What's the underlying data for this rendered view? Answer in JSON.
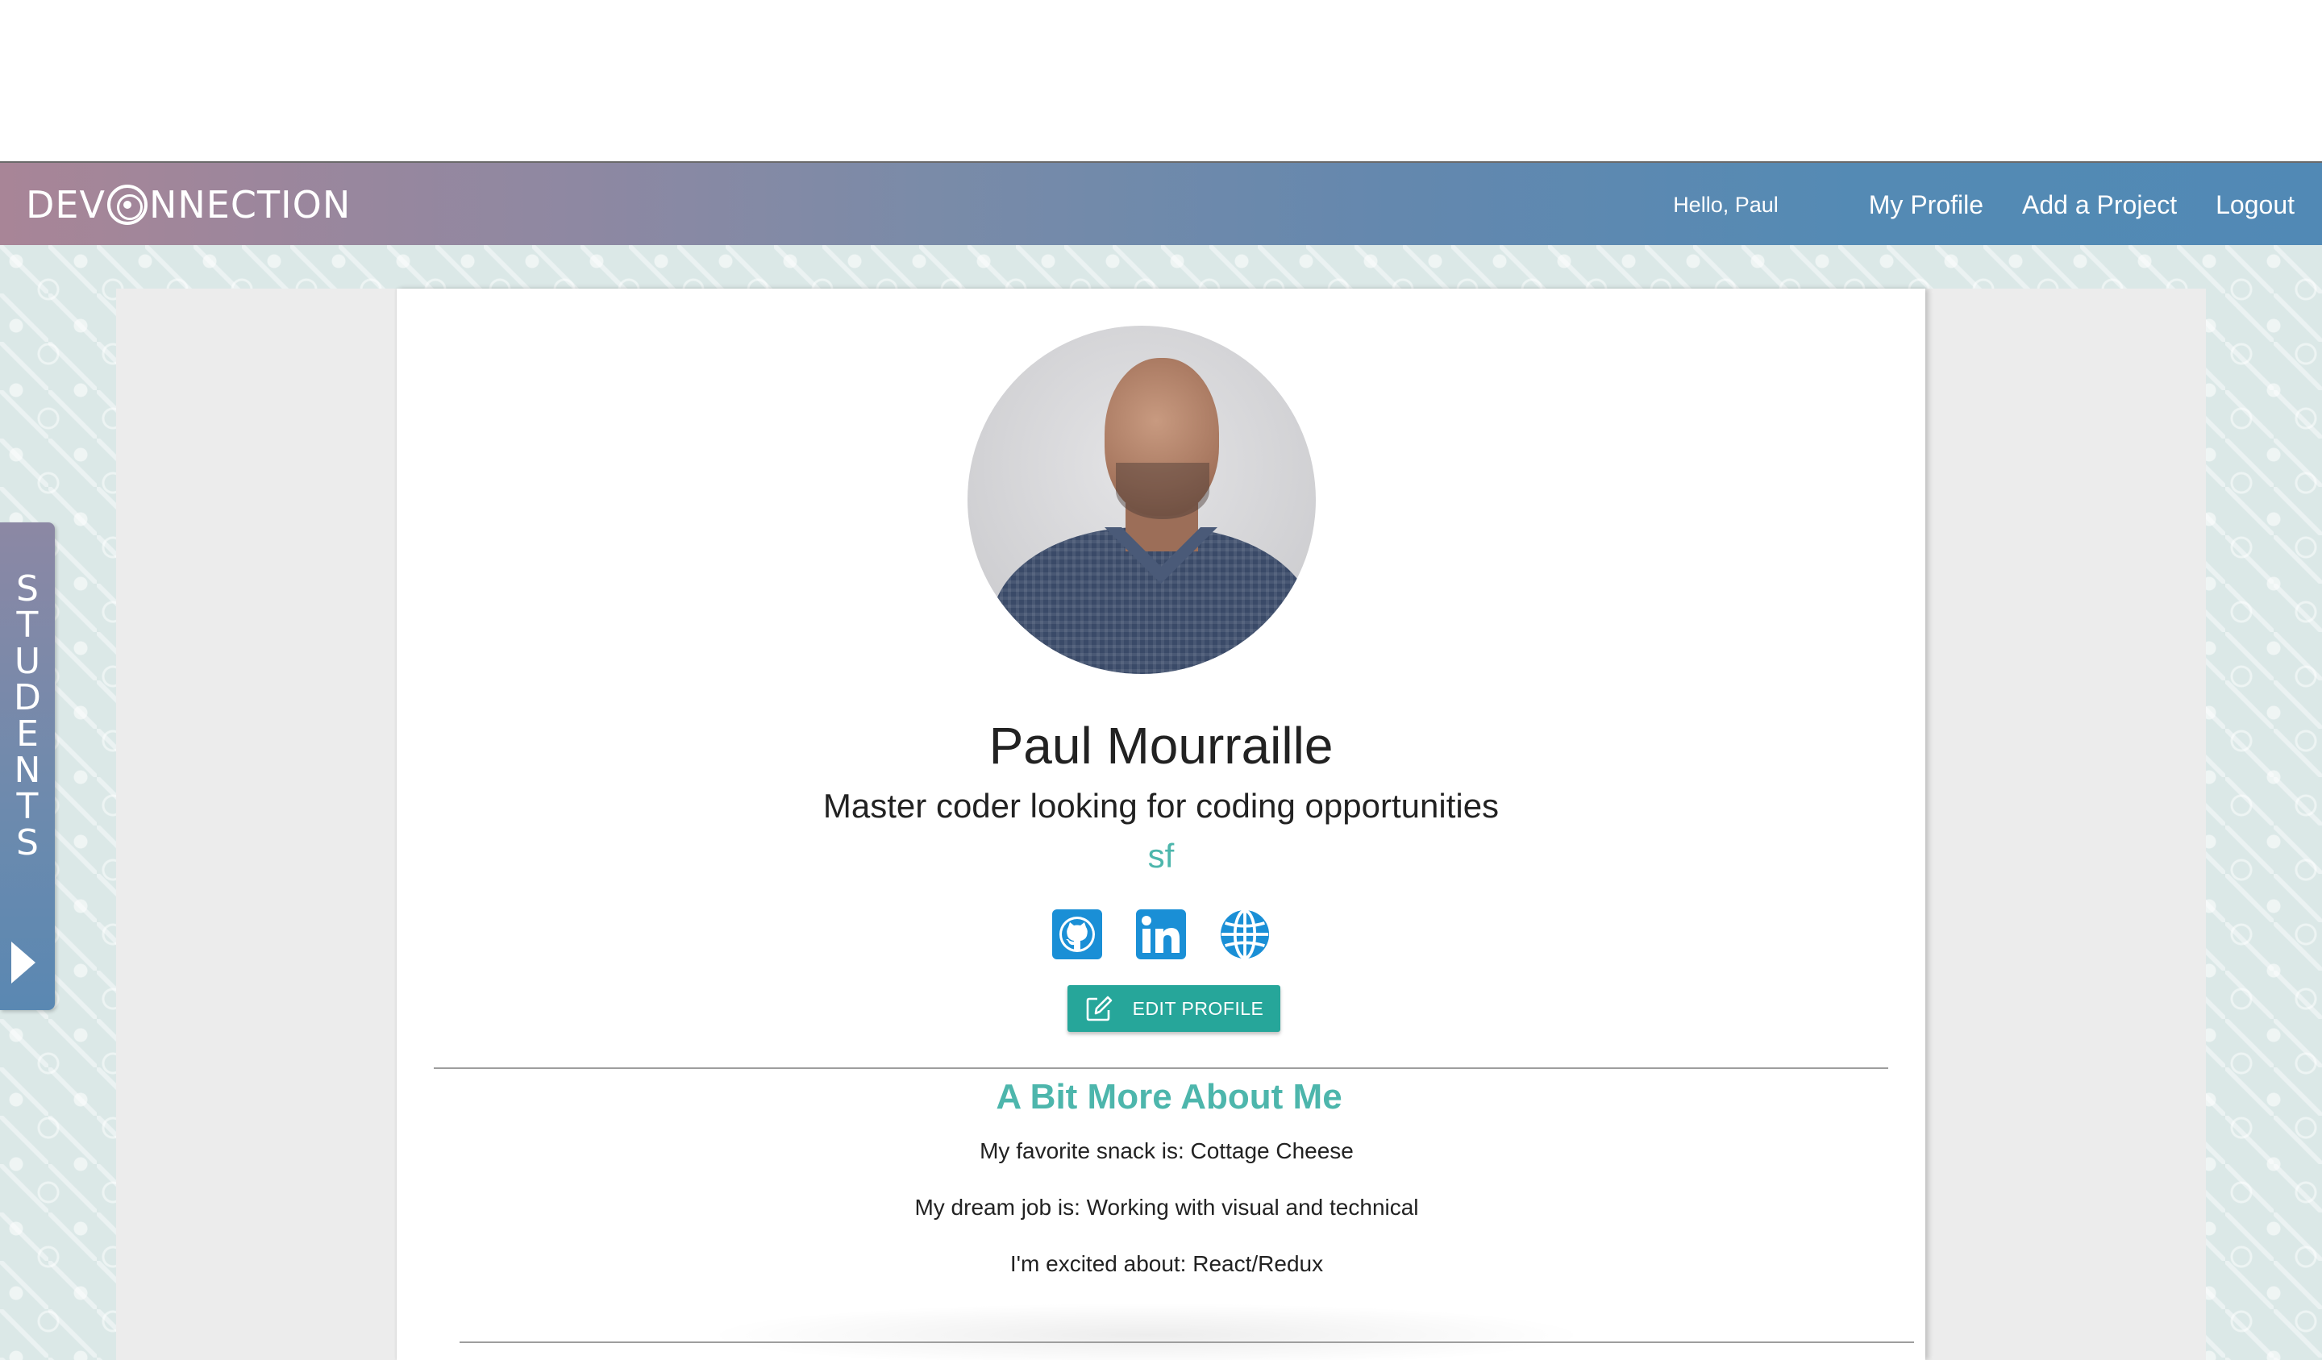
{
  "header": {
    "logo_text_left": "DEV",
    "logo_text_right": "NNECTION",
    "greeting": "Hello, Paul",
    "nav_links": [
      "My Profile",
      "Add a Project",
      "Logout"
    ]
  },
  "sidebar": {
    "tab_label": "STUDENTS"
  },
  "profile": {
    "name": "Paul Mourraille",
    "tagline": "Master coder looking for coding opportunities",
    "location": "sf",
    "socials": [
      "github-icon",
      "linkedin-icon",
      "globe-icon"
    ],
    "edit_button_label": "EDIT PROFILE"
  },
  "about": {
    "title": "A Bit More About Me",
    "lines": [
      "My favorite snack is: Cottage Cheese",
      "My dream job is: Working with visual and technical",
      "I'm excited about: React/Redux"
    ]
  },
  "colors": {
    "accent": "#4db6ac",
    "button": "#26a69a",
    "social_blue": "#1a8fd6"
  }
}
